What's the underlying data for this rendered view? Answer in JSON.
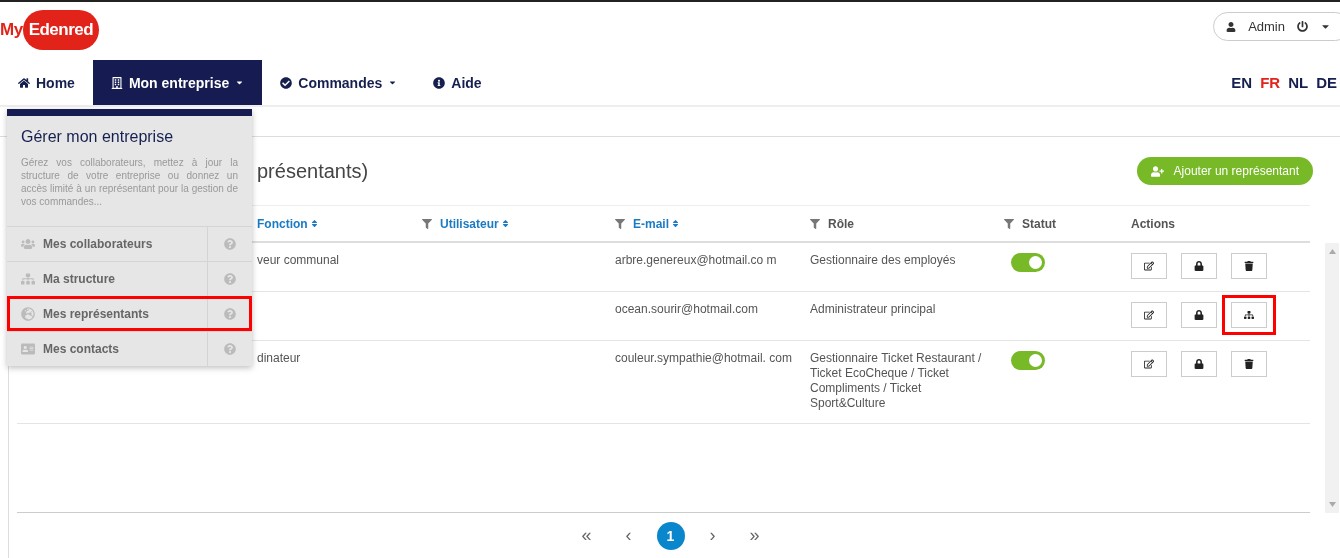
{
  "logo": {
    "prefix": "My",
    "name": "Edenred"
  },
  "user_menu": {
    "label": "Admin"
  },
  "nav": [
    {
      "label": "Home",
      "selected": false,
      "dropdown": false
    },
    {
      "label": "Mon entreprise",
      "selected": true,
      "dropdown": true
    },
    {
      "label": "Commandes",
      "selected": false,
      "dropdown": true
    },
    {
      "label": "Aide",
      "selected": false,
      "dropdown": false
    }
  ],
  "languages": [
    {
      "label": "EN",
      "selected": false
    },
    {
      "label": "FR",
      "selected": true
    },
    {
      "label": "NL",
      "selected": false
    },
    {
      "label": "DE",
      "selected": false
    }
  ],
  "dropdown": {
    "title": "Gérer mon entreprise",
    "description": "Gérez vos collaborateurs, mettez à jour la structure de votre entreprise ou donnez un accès limité à un représentant pour la gestion de vos commandes...",
    "items": [
      {
        "label": "Mes collaborateurs",
        "highlighted": false
      },
      {
        "label": "Ma structure",
        "highlighted": false
      },
      {
        "label": "Mes représentants",
        "highlighted": true
      },
      {
        "label": "Mes contacts",
        "highlighted": false
      }
    ]
  },
  "page": {
    "title": "présentants)",
    "add_button": "Ajouter un représentant"
  },
  "table": {
    "columns": [
      {
        "label": "Fonction",
        "filter": false,
        "sortable": true
      },
      {
        "label": "Utilisateur",
        "filter": true,
        "sortable": true
      },
      {
        "label": "E-mail",
        "filter": true,
        "sortable": true
      },
      {
        "label": "Rôle",
        "filter": true,
        "sortable": false
      },
      {
        "label": "Statut",
        "filter": true,
        "sortable": false
      },
      {
        "label": "Actions",
        "filter": false,
        "sortable": false
      }
    ],
    "rows": [
      {
        "fonction": "veur communal",
        "email": "arbre.genereux@hotmail.co m",
        "role": "Gestionnaire des employés",
        "toggle": {
          "on": true
        },
        "actions": [
          {
            "kind": "edit",
            "highlighted": false
          },
          {
            "kind": "lock",
            "highlighted": false
          },
          {
            "kind": "delete",
            "highlighted": false
          }
        ]
      },
      {
        "fonction": "",
        "email": "ocean.sourir@hotmail.com",
        "role": "Administrateur principal",
        "actions": [
          {
            "kind": "edit",
            "highlighted": false
          },
          {
            "kind": "lock",
            "highlighted": false
          },
          {
            "kind": "hierarchy",
            "highlighted": true
          }
        ]
      },
      {
        "fonction": "dinateur",
        "email": "couleur.sympathie@hotmail. com",
        "role": "Gestionnaire Ticket Restaurant / Ticket EcoCheque / Ticket Compliments / Ticket Sport&Culture",
        "toggle": {
          "on": true
        },
        "actions": [
          {
            "kind": "edit",
            "highlighted": false
          },
          {
            "kind": "lock",
            "highlighted": false
          },
          {
            "kind": "delete",
            "highlighted": false
          }
        ]
      }
    ]
  },
  "pagination": [
    {
      "label": "«",
      "kind": "first",
      "selected": false
    },
    {
      "label": "‹",
      "kind": "prev",
      "selected": false
    },
    {
      "label": "1",
      "kind": "page",
      "selected": true
    },
    {
      "label": "›",
      "kind": "next",
      "selected": false
    },
    {
      "label": "»",
      "kind": "last",
      "selected": false
    }
  ]
}
